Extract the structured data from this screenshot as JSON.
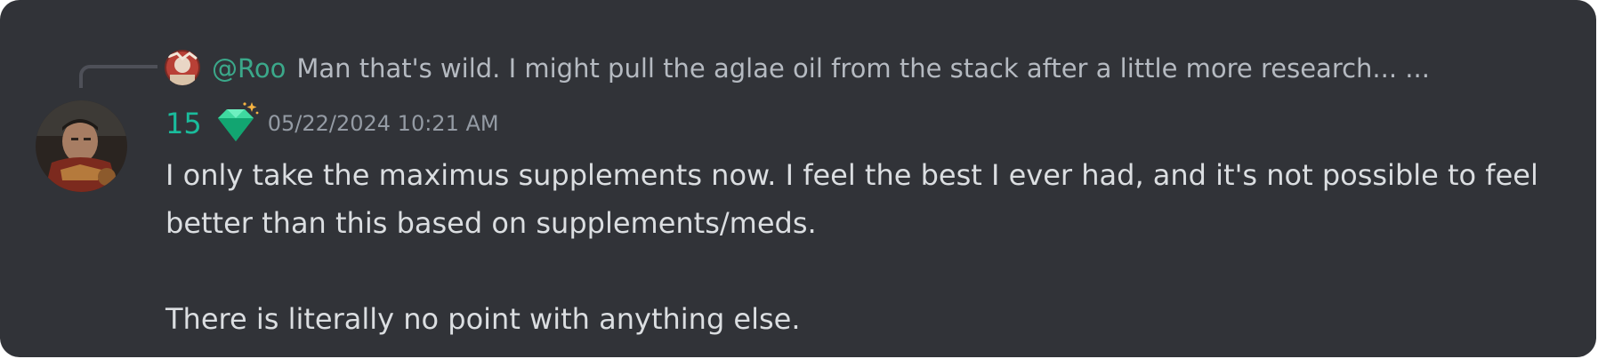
{
  "reply": {
    "username": "@Roo",
    "preview": "Man that's wild. I might pull the aglae oil from the stack after a little more research... ..."
  },
  "message": {
    "author": "15",
    "badge_icon": "green-gem-sparkle-icon",
    "timestamp": "05/22/2024 10:21 AM",
    "lines": [
      "I only take the maximus supplements now. I feel the best I ever had, and it's not possible to feel better than this based on supplements/meds.",
      "There is literally no point with anything else."
    ]
  },
  "colors": {
    "background": "#313338",
    "author": "#1abc9c",
    "reply_user": "#3ba88a",
    "text": "#dbdee1",
    "muted": "#949ba4"
  }
}
